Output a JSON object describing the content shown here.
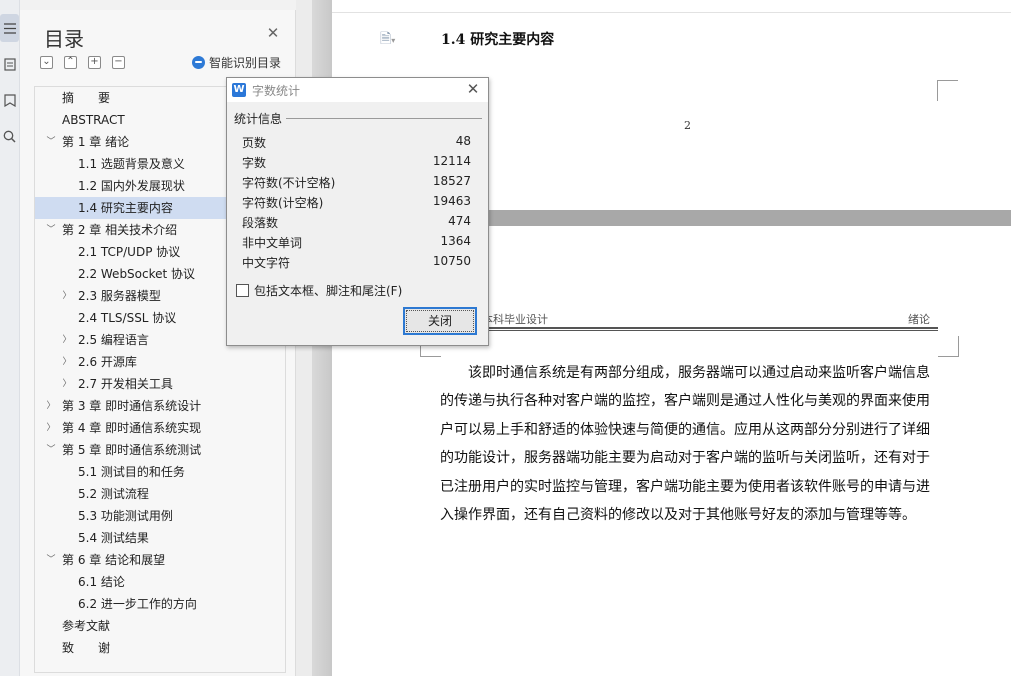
{
  "toc": {
    "title": "目录",
    "smart_label": "智能识别目录",
    "expand_all": "⌄",
    "collapse_all": "⌃",
    "add": "+",
    "remove": "−",
    "items": [
      {
        "label": "摘　　要",
        "arrow": ""
      },
      {
        "label": "ABSTRACT",
        "arrow": ""
      },
      {
        "label": "第 1 章  绪论",
        "arrow": "v"
      },
      {
        "label": "1.1  选题背景及意义",
        "arrow": ""
      },
      {
        "label": "1.2  国内外发展现状",
        "arrow": ""
      },
      {
        "label": "1.4  研究主要内容",
        "arrow": "",
        "selected": true
      },
      {
        "label": "第 2 章  相关技术介绍",
        "arrow": "v"
      },
      {
        "label": "2.1 TCP/UDP 协议",
        "arrow": ""
      },
      {
        "label": "2.2 WebSocket 协议",
        "arrow": ""
      },
      {
        "label": "2.3  服务器模型",
        "arrow": ">"
      },
      {
        "label": "2.4 TLS/SSL 协议",
        "arrow": ""
      },
      {
        "label": "2.5 编程语言",
        "arrow": ">"
      },
      {
        "label": "2.6  开源库",
        "arrow": ">"
      },
      {
        "label": "2.7  开发相关工具",
        "arrow": ">"
      },
      {
        "label": "第 3 章  即时通信系统设计",
        "arrow": ">"
      },
      {
        "label": "第 4 章  即时通信系统实现",
        "arrow": ">"
      },
      {
        "label": "第 5 章  即时通信系统测试",
        "arrow": "v"
      },
      {
        "label": "5.1 测试目的和任务",
        "arrow": ""
      },
      {
        "label": "5.2 测试流程",
        "arrow": ""
      },
      {
        "label": "5.3  功能测试用例",
        "arrow": ""
      },
      {
        "label": "5.4  测试结果",
        "arrow": ""
      },
      {
        "label": "第 6 章  结论和展望",
        "arrow": "v"
      },
      {
        "label": "6.1  结论",
        "arrow": ""
      },
      {
        "label": "6.2  进一步工作的方向",
        "arrow": ""
      },
      {
        "label": "参考文献",
        "arrow": ""
      },
      {
        "label": "致　　谢",
        "arrow": ""
      }
    ]
  },
  "document": {
    "heading": "1.4  研究主要内容",
    "page_number": "2",
    "header_left": "本科毕业设计",
    "header_right": "绪论",
    "body": "该即时通信系统是有两部分组成，服务器端可以通过启动来监听客户端信息的传递与执行各种对客户端的监控，客户端则是通过人性化与美观的界面来使用户可以易上手和舒适的体验快速与简便的通信。应用从这两部分分别进行了详细的功能设计，服务器端功能主要为启动对于客户端的监听与关闭监听，还有对于已注册用户的实时监控与管理，客户端功能主要为使用者该软件账号的申请与进入操作界面，还有自己资料的修改以及对于其他账号好友的添加与管理等等。"
  },
  "dialog": {
    "title": "字数统计",
    "logo": "W",
    "group_label": "统计信息",
    "stats": [
      {
        "label": "页数",
        "value": "48"
      },
      {
        "label": "字数",
        "value": "12114"
      },
      {
        "label": "字符数(不计空格)",
        "value": "18527"
      },
      {
        "label": "字符数(计空格)",
        "value": "19463"
      },
      {
        "label": "段落数",
        "value": "474"
      },
      {
        "label": "非中文单词",
        "value": "1364"
      },
      {
        "label": "中文字符",
        "value": "10750"
      }
    ],
    "checkbox_label": "包括文本框、脚注和尾注(F)",
    "checkbox_checked": false,
    "close_button": "关闭"
  }
}
